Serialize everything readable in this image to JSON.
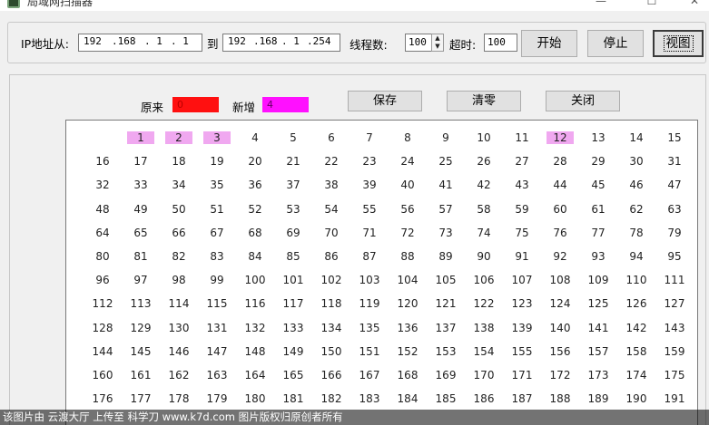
{
  "window": {
    "title": "局域网扫描器",
    "minimize_glyph": "—",
    "maximize_glyph": "☐",
    "close_glyph": "✕"
  },
  "toolbar": {
    "ip_label": "IP地址从:",
    "ip_from": [
      "192",
      ".168",
      ".  1",
      ".  1"
    ],
    "to_label": "到",
    "ip_to": [
      "192",
      ".168",
      ".  1",
      ".254"
    ],
    "threads_label": "线程数:",
    "threads_value": "100",
    "timeout_label": "超时:",
    "timeout_value": "100",
    "start_label": "开始",
    "stop_label": "停止",
    "view_label": "视图"
  },
  "panel": {
    "original_label": "原来",
    "original_count": "0",
    "original_color": "#ff1010",
    "new_label": "新增",
    "new_count": "4",
    "new_color": "#ff10ff",
    "save_label": "保存",
    "clear_label": "清零",
    "close_label": "关闭"
  },
  "grid": {
    "columns": 16,
    "visible_start": 1,
    "visible_end": 191,
    "highlighted": [
      1,
      2,
      3,
      12
    ],
    "highlight_color": "#f0a8f0"
  },
  "watermark": {
    "text": "该图片由 云渡大厅 上传至 科学刀 www.k7d.com 图片版权归原创者所有"
  }
}
